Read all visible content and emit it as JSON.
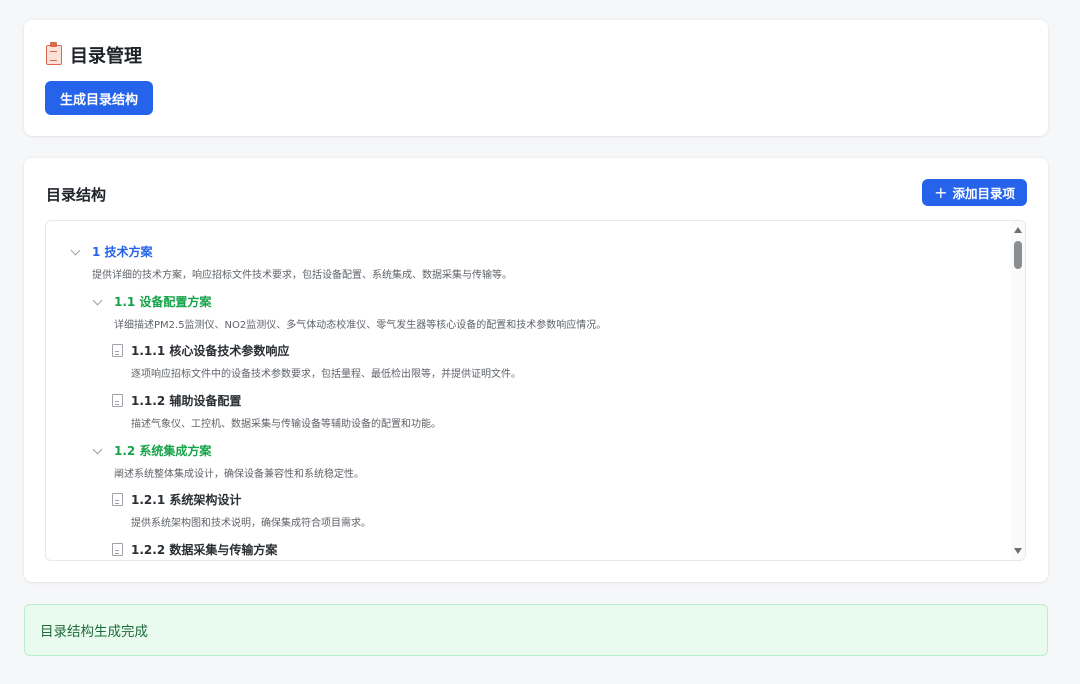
{
  "header": {
    "icon": "clipboard-icon",
    "title": "目录管理",
    "generate_button": "生成目录结构"
  },
  "tree_section": {
    "title": "目录结构",
    "add_button_icon": "plus-icon",
    "add_button": "添加目录项",
    "items": [
      {
        "level": 1,
        "icon": "chevron-down-icon",
        "title": "1 技术方案",
        "desc": "提供详细的技术方案，响应招标文件技术要求，包括设备配置、系统集成、数据采集与传输等。"
      },
      {
        "level": 2,
        "icon": "chevron-down-icon",
        "title": "1.1 设备配置方案",
        "desc": "详细描述PM2.5监测仪、NO2监测仪、多气体动态校准仪、零气发生器等核心设备的配置和技术参数响应情况。"
      },
      {
        "level": 3,
        "icon": "document-icon",
        "title": "1.1.1 核心设备技术参数响应",
        "desc": "逐项响应招标文件中的设备技术参数要求，包括量程、最低检出限等，并提供证明文件。"
      },
      {
        "level": 3,
        "icon": "document-icon",
        "title": "1.1.2 辅助设备配置",
        "desc": "描述气象仪、工控机、数据采集与传输设备等辅助设备的配置和功能。"
      },
      {
        "level": 2,
        "icon": "chevron-down-icon",
        "title": "1.2 系统集成方案",
        "desc": "阐述系统整体集成设计，确保设备兼容性和系统稳定性。"
      },
      {
        "level": 3,
        "icon": "document-icon",
        "title": "1.2.1 系统架构设计",
        "desc": "提供系统架构图和技术说明，确保集成符合项目需求。"
      },
      {
        "level": 3,
        "icon": "document-icon",
        "title": "1.2.2 数据采集与传输方案",
        "desc": ""
      }
    ]
  },
  "status": {
    "message": "目录结构生成完成"
  },
  "colors": {
    "primary": "#2563eb",
    "level1": "#2563eb",
    "level2": "#16a34a",
    "success_bg": "#e9fbee",
    "success_text": "#1e6b3b"
  }
}
